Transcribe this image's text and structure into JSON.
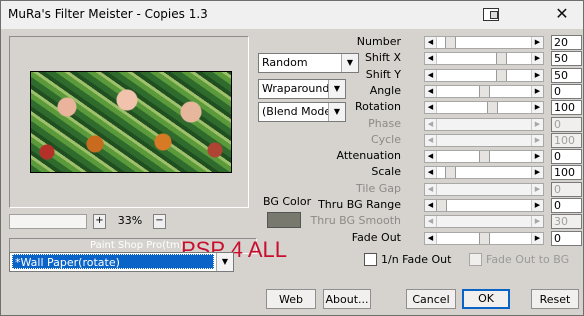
{
  "window": {
    "title": "MuRa's Filter Meister - Copies 1.3",
    "close_glyph": "✕"
  },
  "preview": {
    "zoom": "33%",
    "zoom_plus": "+",
    "zoom_minus": "−",
    "status": "Paint Shop Pro(tm)",
    "watermark": "PSP 4 ALL"
  },
  "dropdowns": {
    "mode": "Random",
    "edge": "Wraparound",
    "blend": "(Blend Mode)"
  },
  "bg_color": {
    "label": "BG Color",
    "color": "#79786f"
  },
  "params": [
    {
      "label": "Number",
      "value": "20",
      "level": 0.1,
      "enabled": true
    },
    {
      "label": "Shift X",
      "value": "50",
      "level": 0.7,
      "enabled": true
    },
    {
      "label": "Shift Y",
      "value": "50",
      "level": 0.7,
      "enabled": true
    },
    {
      "label": "Angle",
      "value": "0",
      "level": 0.5,
      "enabled": true
    },
    {
      "label": "Rotation",
      "value": "100",
      "level": 0.6,
      "enabled": true
    },
    {
      "label": "Phase",
      "value": "0",
      "level": 0.0,
      "enabled": false
    },
    {
      "label": "Cycle",
      "value": "100",
      "level": 0.0,
      "enabled": false
    },
    {
      "label": "Attenuation",
      "value": "0",
      "level": 0.5,
      "enabled": true
    },
    {
      "label": "Scale",
      "value": "100",
      "level": 0.1,
      "enabled": true
    },
    {
      "label": "Tile Gap",
      "value": "0",
      "level": 0.0,
      "enabled": false
    },
    {
      "label": "Thru BG Range",
      "value": "0",
      "level": 0.0,
      "enabled": true
    },
    {
      "label": "Thru BG Smooth",
      "value": "30",
      "level": 0.0,
      "enabled": false
    },
    {
      "label": "Fade Out",
      "value": "0",
      "level": 0.5,
      "enabled": true
    }
  ],
  "checkboxes": [
    {
      "label": "1/n Fade Out",
      "checked": false,
      "enabled": true
    },
    {
      "label": "Fade Out to BG",
      "checked": false,
      "enabled": false
    }
  ],
  "preset": {
    "value": "*Wall Paper(rotate)"
  },
  "buttons": {
    "web": "Web",
    "about": "About...",
    "cancel": "Cancel",
    "ok": "OK",
    "reset": "Reset"
  }
}
